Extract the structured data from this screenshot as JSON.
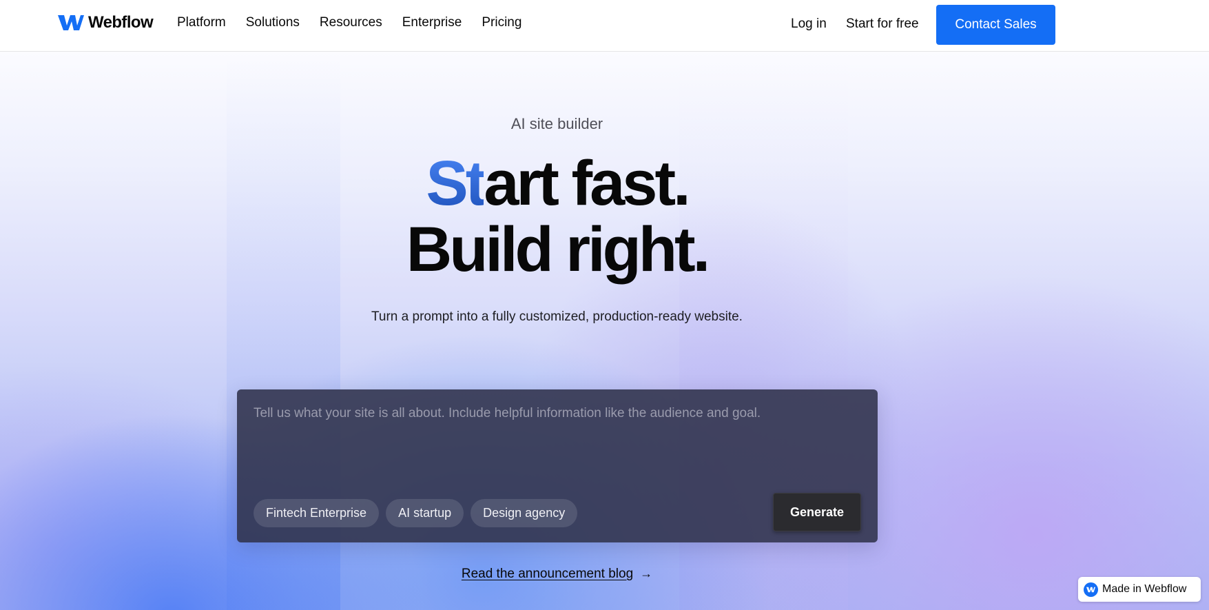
{
  "nav": {
    "logo_text": "Webflow",
    "links": [
      "Platform",
      "Solutions",
      "Resources",
      "Enterprise",
      "Pricing"
    ],
    "login": "Log in",
    "start_free": "Start for free",
    "contact_sales": "Contact Sales"
  },
  "hero": {
    "eyebrow": "AI site builder",
    "headline_accent": "St",
    "headline_rest": "art fast.",
    "headline_line2": "Build right.",
    "subhead": "Turn a prompt into a fully customized, production-ready website."
  },
  "prompt": {
    "placeholder": "Tell us what your site is all about. Include helpful information like the audience and goal.",
    "chips": [
      "Fintech Enterprise",
      "AI startup",
      "Design agency"
    ],
    "generate": "Generate"
  },
  "blog_link": {
    "label": "Read the announcement blog",
    "arrow": "→"
  },
  "badge": {
    "label": "Made in Webflow"
  },
  "colors": {
    "brand_blue": "#146ef5",
    "text": "#080808",
    "card_bg": "#2f314a"
  },
  "icons": [
    "webflow-logo-icon",
    "arrow-right-icon",
    "webflow-badge-icon"
  ]
}
